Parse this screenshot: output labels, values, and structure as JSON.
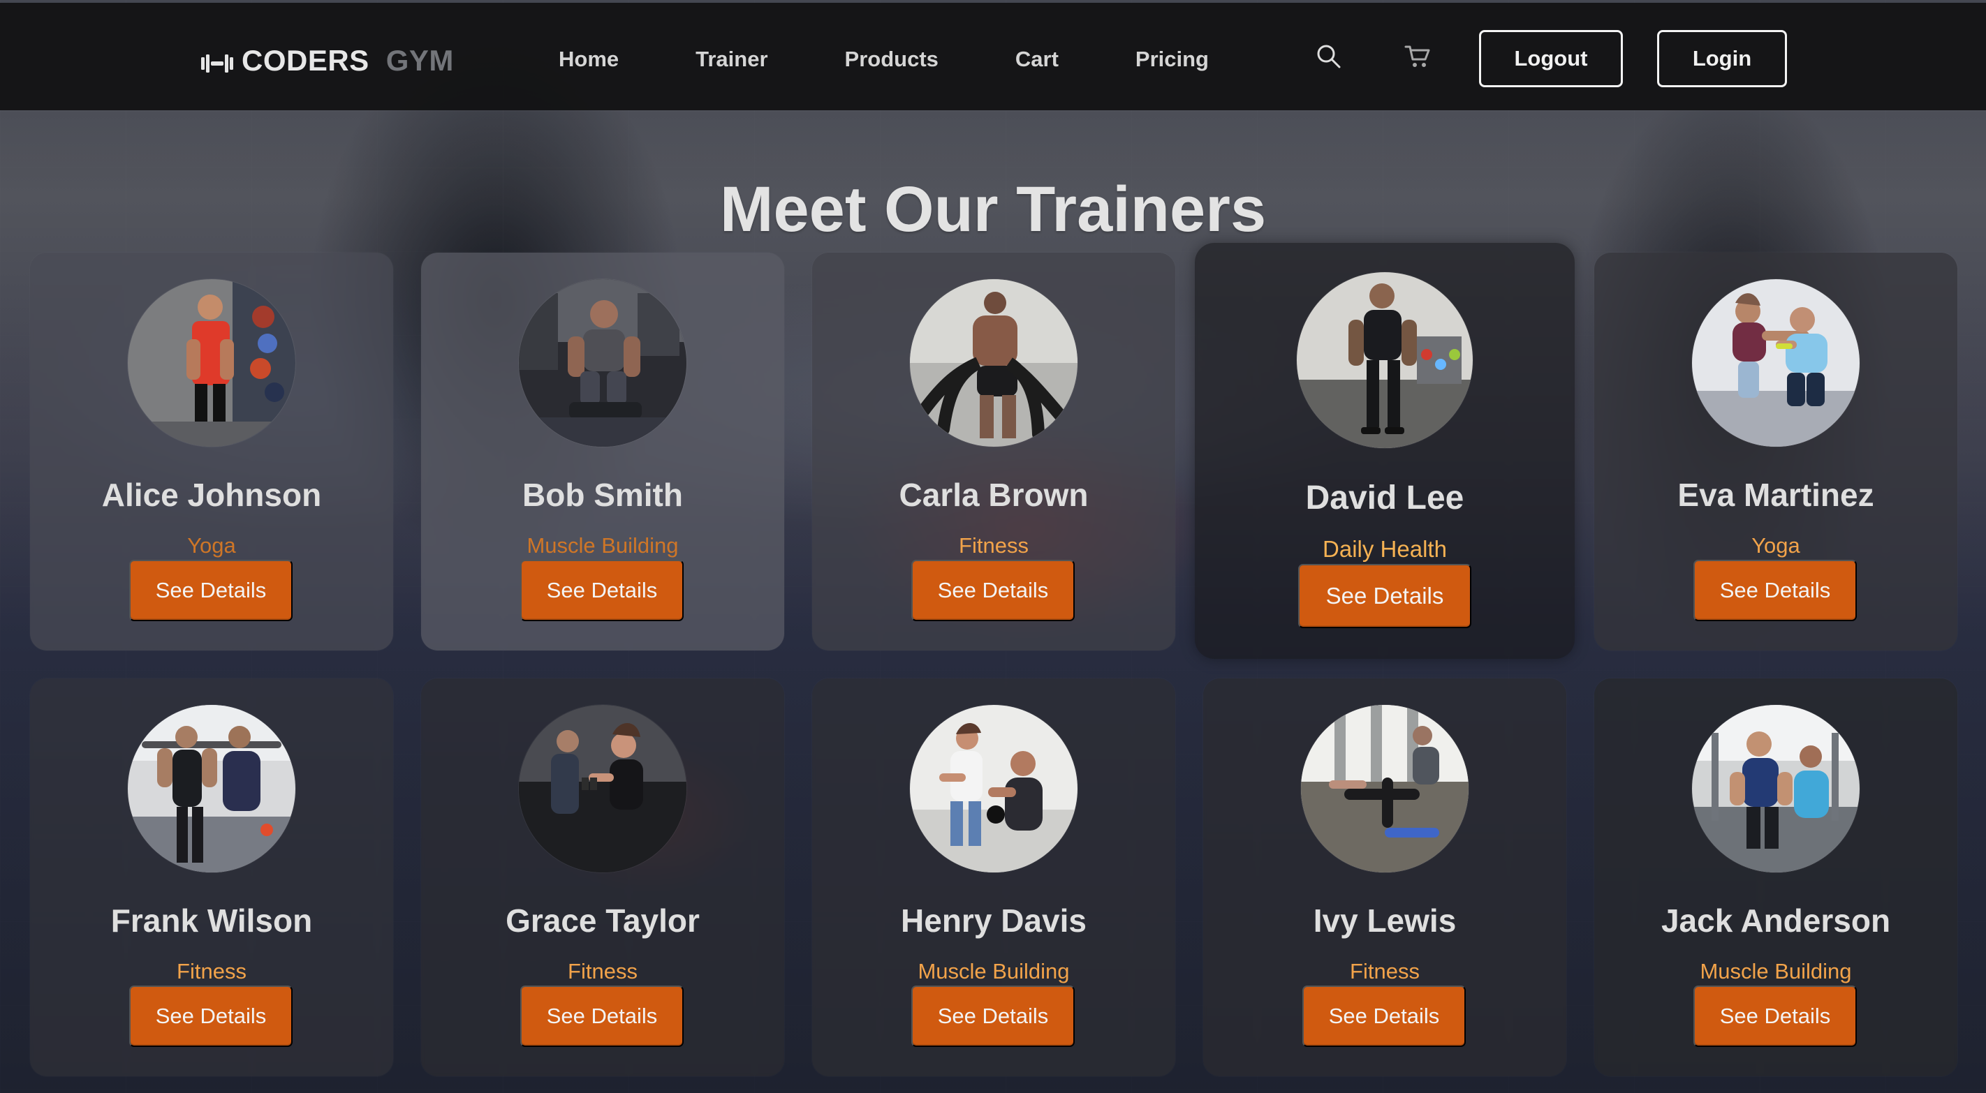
{
  "header": {
    "logo_main": "CODERS",
    "logo_accent": "GYM",
    "nav": [
      "Home",
      "Trainer",
      "Products",
      "Cart",
      "Pricing"
    ],
    "buttons": {
      "logout": "Logout",
      "login": "Login"
    },
    "icons": {
      "search": "search-icon",
      "cart": "cart-icon",
      "logo": "dumbbell-logo-icon"
    }
  },
  "page": {
    "title": "Meet Our Trainers"
  },
  "trainers": [
    {
      "name": "Alice Johnson",
      "specialty": "Yoga",
      "button": "See Details"
    },
    {
      "name": "Bob Smith",
      "specialty": "Muscle Building",
      "button": "See Details"
    },
    {
      "name": "Carla Brown",
      "specialty": "Fitness",
      "button": "See Details"
    },
    {
      "name": "David Lee",
      "specialty": "Daily Health",
      "button": "See Details"
    },
    {
      "name": "Eva Martinez",
      "specialty": "Yoga",
      "button": "See Details"
    },
    {
      "name": "Frank Wilson",
      "specialty": "Fitness",
      "button": "See Details"
    },
    {
      "name": "Grace Taylor",
      "specialty": "Fitness",
      "button": "See Details"
    },
    {
      "name": "Henry Davis",
      "specialty": "Muscle Building",
      "button": "See Details"
    },
    {
      "name": "Ivy Lewis",
      "specialty": "Fitness",
      "button": "See Details"
    },
    {
      "name": "Jack Anderson",
      "specialty": "Muscle Building",
      "button": "See Details"
    }
  ],
  "theme": {
    "accent": "#d05a10",
    "specialty_color": "#f2a34a",
    "nav_bg": "#111112"
  }
}
